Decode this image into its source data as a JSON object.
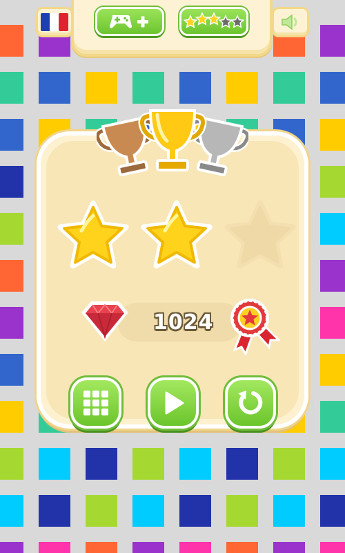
{
  "top_bar": {
    "language_flag": "flag-france-icon",
    "add_game_icon": "gamepad-plus-icon",
    "rate_stars": {
      "filled": 3,
      "total": 5
    },
    "sound_icon": "speaker-icon"
  },
  "result": {
    "trophies": [
      "bronze",
      "gold",
      "silver"
    ],
    "stars_earned": 2,
    "stars_total": 3,
    "score": "1024",
    "gem_icon": "ruby-heart-icon",
    "badge_icon": "star-rosette-icon"
  },
  "actions": {
    "menu_icon": "level-grid-icon",
    "play_icon": "play-icon",
    "replay_icon": "replay-icon"
  },
  "colors": {
    "background": "#d9d9d9",
    "tile_palette": [
      "#ff6633",
      "#3366cc",
      "#a6d832",
      "#9933cc",
      "#ffcc00",
      "#00ccff",
      "#ff33aa",
      "#33cc99",
      "#2233aa"
    ]
  }
}
